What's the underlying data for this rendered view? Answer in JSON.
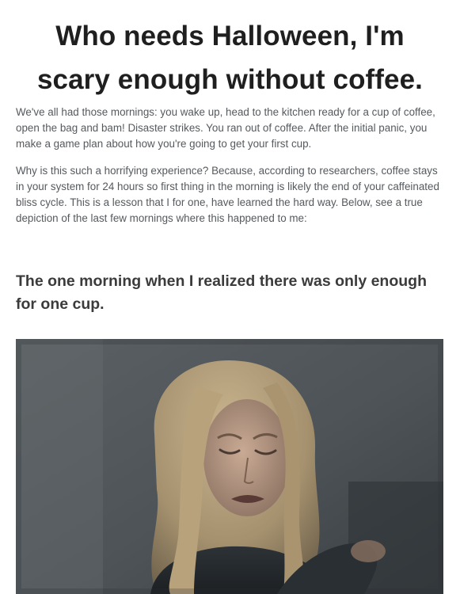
{
  "article": {
    "title": "Who needs Halloween, I'm scary enough without coffee.",
    "paragraphs": [
      "We've all had those mornings: you wake up, head to the kitchen ready for a cup of coffee, open the bag and bam! Disaster strikes. You ran out of coffee. After the initial panic, you make a game plan about how you're going to get your first cup.",
      "Why is this such a horrifying experience? Because, according to researchers, coffee stays in your system for 24 hours so first thing in the morning is likely the end of your caffeinated bliss cycle. This is a lesson that I for one, have learned the hard way. Below, see a true depiction of the last few mornings where this happened to me:"
    ],
    "subheading": "The one morning when I realized there was only enough for one cup."
  },
  "colors": {
    "title": "#1f1f1f",
    "body_text": "#555a5e",
    "subheading": "#3b3b3b",
    "image_background": "#4f5559"
  }
}
